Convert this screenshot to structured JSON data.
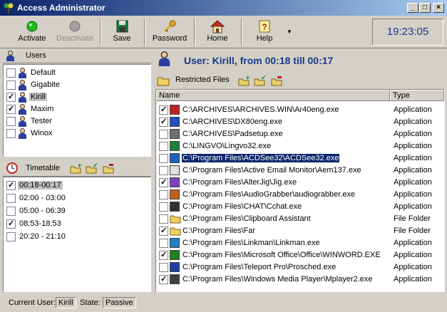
{
  "window": {
    "title": "Access Administrator"
  },
  "toolbar": {
    "buttons": [
      {
        "label": "Activate",
        "icon": "green-dot-icon",
        "enabled": true
      },
      {
        "label": "Deactivate",
        "icon": "gray-dot-icon",
        "enabled": false
      },
      {
        "label": "Save",
        "icon": "floppy-disk-icon",
        "enabled": true
      },
      {
        "label": "Password",
        "icon": "key-icon",
        "enabled": true
      },
      {
        "label": "Home",
        "icon": "house-icon",
        "enabled": true
      },
      {
        "label": "Help",
        "icon": "help-icon",
        "enabled": true
      }
    ],
    "clock": "19:23:05"
  },
  "users": {
    "header": "Users",
    "items": [
      {
        "name": "Default",
        "checked": false
      },
      {
        "name": "Gigabite",
        "checked": false
      },
      {
        "name": "Kirill",
        "checked": true,
        "selected": true
      },
      {
        "name": "Maxim",
        "checked": true
      },
      {
        "name": "Tester",
        "checked": false
      },
      {
        "name": "Winox",
        "checked": false
      }
    ]
  },
  "timetable": {
    "header": "Timetable",
    "items": [
      {
        "label": "00:18-00:17",
        "checked": true,
        "selected": true
      },
      {
        "label": "02:00 - 03:00",
        "checked": false
      },
      {
        "label": "05:00 - 06:39",
        "checked": false
      },
      {
        "label": "08:53-18:53",
        "checked": true
      },
      {
        "label": "20:20 - 21:10",
        "checked": false
      }
    ]
  },
  "detail": {
    "user_heading": "User: Kirill, from 00:18 till 00:17",
    "restricted_label": "Restricted Files",
    "columns": {
      "name": "Name",
      "type": "Type"
    },
    "files": [
      {
        "path": "C:\\ARCHIVES\\ARCHIVES.WIN\\Ar40eng.exe",
        "type": "Application",
        "checked": true,
        "icon": "archive-red-icon"
      },
      {
        "path": "C:\\ARCHIVES\\DX80eng.exe",
        "type": "Application",
        "checked": true,
        "icon": "app-window-icon"
      },
      {
        "path": "C:\\ARCHIVES\\Padsetup.exe",
        "type": "Application",
        "checked": false,
        "icon": "setup-box-icon"
      },
      {
        "path": "C:\\LINGVO\\Lingvo32.exe",
        "type": "Application",
        "checked": false,
        "icon": "lingvo-book-icon"
      },
      {
        "path": "C:\\Program Files\\ACDSee32\\ACDSee32.exe",
        "type": "Application",
        "checked": false,
        "icon": "acdsee-eye-icon",
        "selected": true
      },
      {
        "path": "C:\\Program Files\\Active Email Monitor\\Aem137.exe",
        "type": "Application",
        "checked": false,
        "icon": "envelope-icon"
      },
      {
        "path": "C:\\Program Files\\AlterJig\\Jig.exe",
        "type": "Application",
        "checked": true,
        "icon": "puzzle-icon"
      },
      {
        "path": "C:\\Program Files\\AudioGrabber\\audiograbber.exe",
        "type": "Application",
        "checked": false,
        "icon": "audio-grabber-icon"
      },
      {
        "path": "C:\\Program Files\\CHAT\\Cchat.exe",
        "type": "Application",
        "checked": false,
        "icon": "chat-people-icon"
      },
      {
        "path": "C:\\Program Files\\Clipboard Assistant",
        "type": "File Folder",
        "checked": false,
        "icon": "folder-icon"
      },
      {
        "path": "C:\\Program Files\\Far",
        "type": "File Folder",
        "checked": true,
        "icon": "folder-icon"
      },
      {
        "path": "C:\\Program Files\\Linkman\\Linkman.exe",
        "type": "Application",
        "checked": false,
        "icon": "globe-icon"
      },
      {
        "path": "C:\\Program Files\\Microsoft Office\\Office\\WINWORD.EXE",
        "type": "Application",
        "checked": true,
        "icon": "word-w-icon"
      },
      {
        "path": "C:\\Program Files\\Teleport Pro\\Prosched.exe",
        "type": "Application",
        "checked": false,
        "icon": "teleport-icon"
      },
      {
        "path": "C:\\Program Files\\Windows Media Player\\Mplayer2.exe",
        "type": "Application",
        "checked": true,
        "icon": "media-player-icon"
      }
    ]
  },
  "status": {
    "current_user_label": "Current User:",
    "current_user": "Kirill",
    "state_label": "State:",
    "state": "Passive"
  },
  "colors": {
    "title_start": "#0a246a",
    "title_end": "#a6caf0",
    "heading_blue": "#1a3a8a",
    "face": "#d4d0c8",
    "selection": "#0a246a"
  }
}
